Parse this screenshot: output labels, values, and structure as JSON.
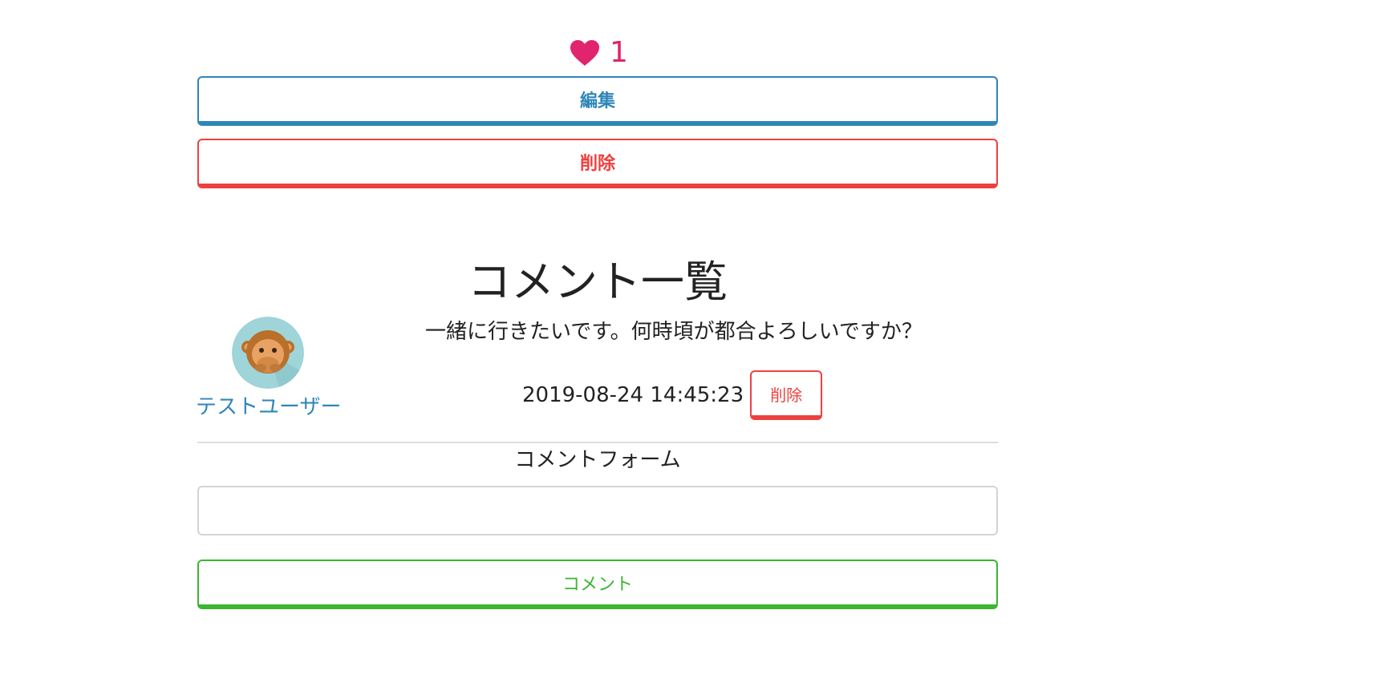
{
  "like": {
    "count": "1",
    "color": "#e0246e",
    "icon": "heart-icon"
  },
  "actions": {
    "edit_label": "編集",
    "delete_label": "削除"
  },
  "comments_section": {
    "title": "コメント一覧",
    "comments": [
      {
        "user_name": "テストユーザー",
        "avatar_icon": "monkey-avatar-icon",
        "text": "一緒に行きたいです。何時頃が都合よろしいですか？",
        "timestamp": "2019-08-24 14:45:23",
        "delete_label": "削除"
      }
    ]
  },
  "comment_form": {
    "label": "コメントフォーム",
    "input_value": "",
    "submit_label": "コメント"
  },
  "colors": {
    "primary": "#2e86b8",
    "danger": "#ef4040",
    "success": "#3cb531",
    "like": "#e0246e"
  }
}
